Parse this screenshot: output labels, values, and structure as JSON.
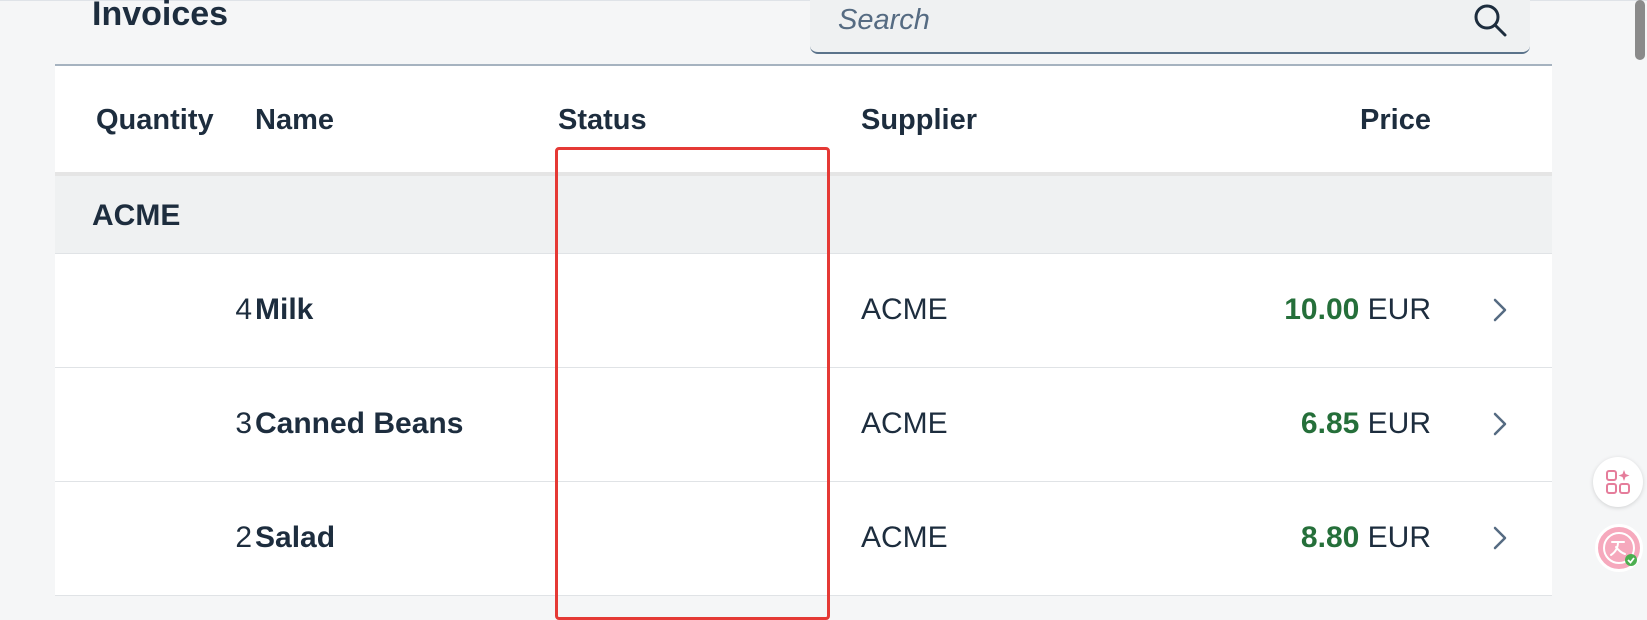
{
  "page": {
    "title": "Invoices"
  },
  "search": {
    "placeholder": "Search",
    "icon": "search-icon"
  },
  "table": {
    "columns": [
      "Quantity",
      "Name",
      "Status",
      "Supplier",
      "Price"
    ],
    "group": {
      "label": "ACME"
    },
    "rows": [
      {
        "quantity": "4",
        "name": "Milk",
        "status": "",
        "supplier": "ACME",
        "price": "10.00",
        "currency": "EUR"
      },
      {
        "quantity": "3",
        "name": "Canned Beans",
        "status": "",
        "supplier": "ACME",
        "price": "6.85",
        "currency": "EUR"
      },
      {
        "quantity": "2",
        "name": "Salad",
        "status": "",
        "supplier": "ACME",
        "price": "8.80",
        "currency": "EUR"
      }
    ]
  },
  "colors": {
    "price_positive": "#256f3a",
    "highlight_border": "#e53935",
    "text": "#1d2d3e"
  }
}
